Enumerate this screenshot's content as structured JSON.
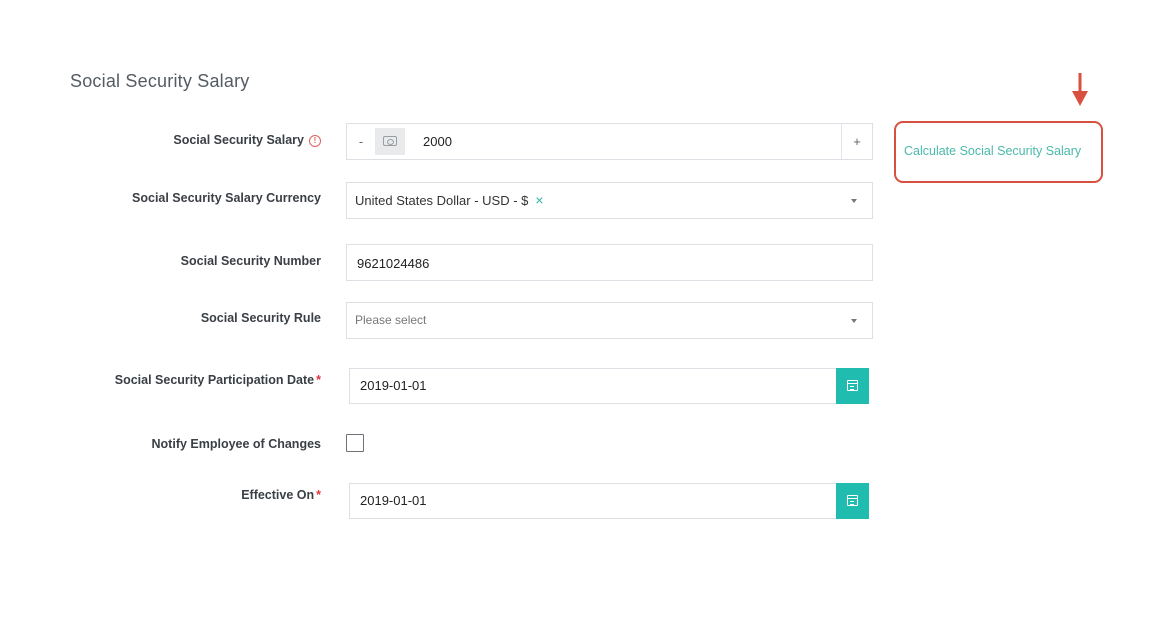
{
  "section": {
    "title": "Social Security Salary"
  },
  "fields": {
    "salary": {
      "label": "Social Security Salary",
      "info_icon": "exclamation-circle-icon",
      "minus_label": "-",
      "plus_label": "+",
      "currency_icon": "money-bill-icon",
      "value": "2000"
    },
    "currency": {
      "label": "Social Security Salary Currency",
      "value": "United States Dollar - USD - $",
      "clear_glyph": "×",
      "caret_icon": "chevron-down-icon"
    },
    "number": {
      "label": "Social Security Number",
      "value": "9621024486"
    },
    "rule": {
      "label": "Social Security Rule",
      "placeholder": "Please select",
      "caret_icon": "chevron-down-icon"
    },
    "participation_date": {
      "label": "Social Security Participation Date",
      "required_mark": "*",
      "value": "2019-01-01",
      "calendar_icon": "calendar-icon"
    },
    "notify": {
      "label": "Notify Employee of Changes",
      "checked": false
    },
    "effective_on": {
      "label": "Effective On",
      "required_mark": "*",
      "value": "2019-01-01",
      "calendar_icon": "calendar-icon"
    }
  },
  "calculate_link": {
    "label": "Calculate Social Security Salary",
    "link_color": "#4ab9ab",
    "highlight_color": "#d8503f"
  },
  "colors": {
    "accent": "#1fbcaf",
    "required": "#e0353b",
    "annotation": "#d8503f"
  }
}
